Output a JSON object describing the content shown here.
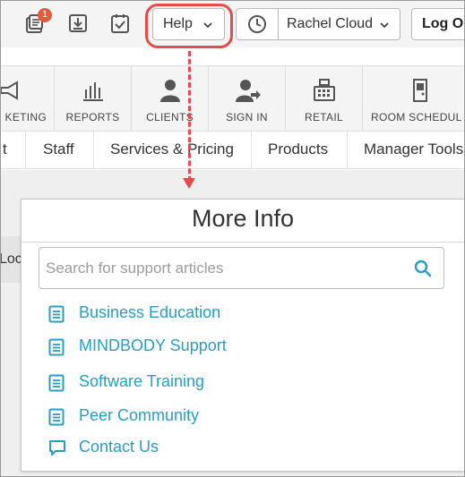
{
  "topbar": {
    "notification_count": "1",
    "help_label": "Help",
    "user_name": "Rachel Cloud",
    "logout_label": "Log Ou"
  },
  "nav": {
    "items": [
      {
        "label": "KETING",
        "icon": "megaphone-icon"
      },
      {
        "label": "REPORTS",
        "icon": "bar-chart-icon"
      },
      {
        "label": "CLIENTS",
        "icon": "person-icon"
      },
      {
        "label": "SIGN IN",
        "icon": "person-sign-in-icon"
      },
      {
        "label": "RETAIL",
        "icon": "cash-register-icon"
      },
      {
        "label": "ROOM SCHEDUL",
        "icon": "door-icon"
      }
    ]
  },
  "tabs": [
    "t",
    "Staff",
    "Services & Pricing",
    "Products",
    "Manager Tools"
  ],
  "background": {
    "side_text": "Loc"
  },
  "popup": {
    "title": "More Info",
    "search_placeholder": "Search for support articles",
    "links": [
      {
        "label": "Business Education",
        "icon": "document-icon"
      },
      {
        "label": "MINDBODY Support",
        "icon": "document-icon"
      },
      {
        "label": "Software Training",
        "icon": "document-icon"
      },
      {
        "label": "Peer Community",
        "icon": "document-icon"
      },
      {
        "label": "Contact Us",
        "icon": "chat-bubble-icon"
      }
    ]
  },
  "colors": {
    "accent_link": "#2a9dc4",
    "highlight_red": "#e74a4a",
    "badge": "#e8583a"
  }
}
